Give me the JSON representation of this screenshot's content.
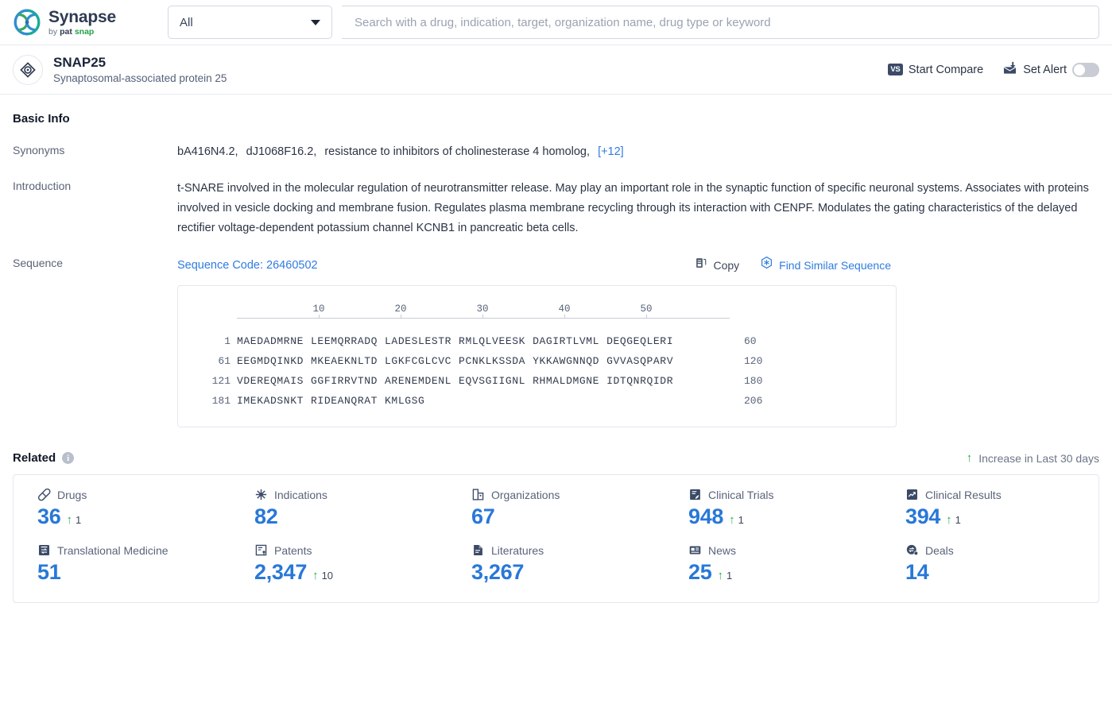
{
  "topbar": {
    "brand_name": "Synapse",
    "brand_by": "by",
    "brand_pat": "pat",
    "brand_snap": "snap",
    "logo_icon": "synapse-logo-icon",
    "selector_value": "All",
    "selector_caret_icon": "chevron-down-icon",
    "search_placeholder": "Search with a drug, indication, target, organization name, drug type or keyword",
    "search_value": ""
  },
  "entity": {
    "avatar_icon": "target-protein-icon",
    "title": "SNAP25",
    "subtitle": "Synaptosomal-associated protein 25",
    "compare_label": "Start Compare",
    "compare_badge": "VS",
    "compare_icon": "vs-badge-icon",
    "alert_label": "Set Alert",
    "alert_icon": "mailbox-alert-icon",
    "alert_toggle_state": "off"
  },
  "basic_info": {
    "section_title": "Basic Info",
    "synonyms_label": "Synonyms",
    "synonyms": [
      "bA416N4.2,",
      "dJ1068F16.2,",
      "resistance to inhibitors of cholinesterase 4 homolog,"
    ],
    "synonyms_more": "[+12]",
    "introduction_label": "Introduction",
    "introduction": "t-SNARE involved in the molecular regulation of neurotransmitter release. May play an important role in the synaptic function of specific neuronal systems. Associates with proteins involved in vesicle docking and membrane fusion. Regulates plasma membrane recycling through its interaction with CENPF. Modulates the gating characteristics of the delayed rectifier voltage-dependent potassium channel KCNB1 in pancreatic beta cells.",
    "sequence_label": "Sequence",
    "sequence_code": "Sequence Code: 26460502",
    "copy_label": "Copy",
    "copy_icon": "copy-documents-icon",
    "find_similar_label": "Find Similar Sequence",
    "find_similar_icon": "hexagon-sparkle-icon"
  },
  "sequence": {
    "ruler_ticks": [
      "10",
      "20",
      "30",
      "40",
      "50"
    ],
    "rows": [
      {
        "start": "1",
        "blocks": [
          "MAEDADMRNE",
          "LEEMQRRADQ",
          "LADESLESTR",
          "RMLQLVEESK",
          "DAGIRTLVML",
          "DEQGEQLERI"
        ],
        "end": "60"
      },
      {
        "start": "61",
        "blocks": [
          "EEGMDQINKD",
          "MKEAEKNLTD",
          "LGKFCGLCVC",
          "PCNKLKSSDA",
          "YKKAWGNNQD",
          "GVVASQPARV"
        ],
        "end": "120"
      },
      {
        "start": "121",
        "blocks": [
          "VDEREQMAIS",
          "GGFIRRVTND",
          "ARENEMDENL",
          "EQVSGIIGNL",
          "RHMALDMGNE",
          "IDTQNRQIDR"
        ],
        "end": "180"
      },
      {
        "start": "181",
        "blocks": [
          "IMEKADSNKT",
          "RIDEANQRAT",
          "KMLGSG"
        ],
        "end": "206"
      }
    ]
  },
  "related": {
    "title": "Related",
    "info_icon": "info-circle-icon",
    "info_glyph": "i",
    "legend_arrow_icon": "arrow-up-icon",
    "legend_arrow_glyph": "↑",
    "legend_label": "Increase in Last 30 days",
    "metrics": [
      {
        "label": "Drugs",
        "icon": "pill-icon",
        "value": "36",
        "delta": "1"
      },
      {
        "label": "Indications",
        "icon": "virus-icon",
        "value": "82",
        "delta": ""
      },
      {
        "label": "Organizations",
        "icon": "building-icon",
        "value": "67",
        "delta": ""
      },
      {
        "label": "Clinical Trials",
        "icon": "clipboard-flask-icon",
        "value": "948",
        "delta": "1"
      },
      {
        "label": "Clinical Results",
        "icon": "report-chart-icon",
        "value": "394",
        "delta": "1"
      },
      {
        "label": "Translational Medicine",
        "icon": "translational-icon",
        "value": "51",
        "delta": ""
      },
      {
        "label": "Patents",
        "icon": "patent-icon",
        "value": "2,347",
        "delta": "10"
      },
      {
        "label": "Literatures",
        "icon": "literature-icon",
        "value": "3,267",
        "delta": ""
      },
      {
        "label": "News",
        "icon": "news-icon",
        "value": "25",
        "delta": "1"
      },
      {
        "label": "Deals",
        "icon": "deals-icon",
        "value": "14",
        "delta": ""
      }
    ]
  },
  "colors": {
    "accent_blue": "#2878d8",
    "link_blue": "#2f7ce0",
    "increase_green": "#2cb34a",
    "brand_green": "#24a148",
    "text_dark": "#1b2539",
    "text_muted": "#59637a",
    "border": "#e4e7ee"
  }
}
